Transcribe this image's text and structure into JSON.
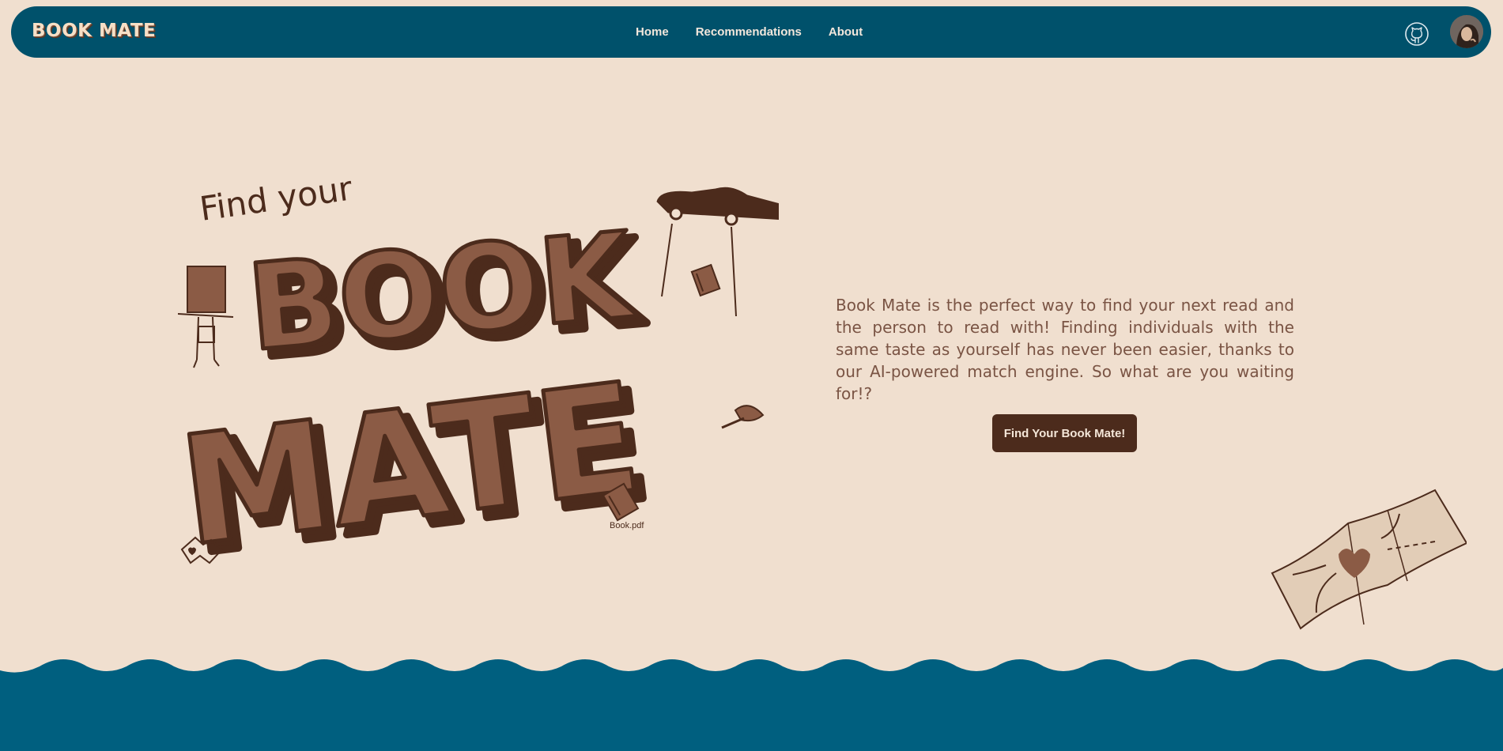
{
  "nav": {
    "logo": "BOOK MATE",
    "links": [
      "Home",
      "Recommendations",
      "About"
    ],
    "github_icon": "github-icon",
    "avatar_icon": "user-avatar"
  },
  "hero": {
    "art_tagline": "Find your",
    "art_title_line1": "BOOK",
    "art_title_line2": "MATE",
    "art_caption": "Book.pdf",
    "description": "Book Mate is the perfect way to find your next read and the person to read with! Finding individuals with the same taste as yourself has never been easier, thanks to our AI-powered match engine. So what are you waiting for!?",
    "cta_label": "Find Your Book Mate!"
  },
  "colors": {
    "background": "#f0dfcf",
    "navbar": "#00516b",
    "footer": "#005f7f",
    "brown_dark": "#4c2b1c",
    "brown_letter": "#8b5b45",
    "text": "#7a5444"
  }
}
